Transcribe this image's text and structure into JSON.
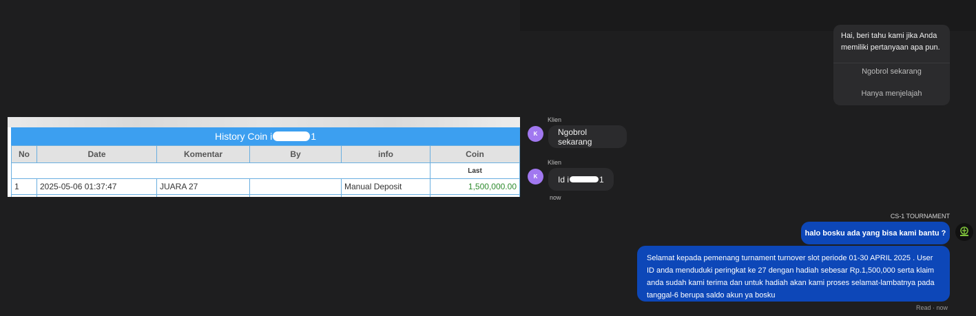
{
  "history": {
    "title_prefix": "History Coin i",
    "title_suffix": "1",
    "columns": [
      "No",
      "Date",
      "Komentar",
      "By",
      "info",
      "Coin"
    ],
    "subheader_last": "Last",
    "rows": [
      {
        "no": "1",
        "date": "2025-05-06 01:37:47",
        "komentar": "JUARA 27",
        "by": "",
        "info": "Manual Deposit",
        "coin": "1,500,000.00"
      }
    ]
  },
  "chat": {
    "welcome": {
      "text": "Hai, beri tahu kami jika Anda memiliki pertanyaan apa pun.",
      "option_1": "Ngobrol sekarang",
      "option_2": "Hanya menjelajah"
    },
    "client_msg_1": {
      "sender": "Klien",
      "avatar": "K",
      "text": "Ngobrol sekarang"
    },
    "client_msg_2": {
      "sender": "Klien",
      "avatar": "K",
      "text_prefix": "Id i",
      "text_suffix": "1",
      "time": "now"
    },
    "agent": {
      "name": "CS-1 TOURNAMENT",
      "msg_1": "halo bosku ada yang bisa kami bantu ?",
      "msg_2": "Selamat kepada pemenang turnament turnover slot periode 01-30 APRIL 2025 . User ID anda menduduki peringkat ke 27 dengan hadiah sebesar Rp.1,500,000 serta klaim anda sudah kami terima dan untuk hadiah akan kami proses selamat-lambatnya pada tanggal-6 berupa saldo akun ya bosku",
      "read_status": "Read · now"
    },
    "colors": {
      "agent_bubble": "#0d47b8",
      "client_bubble": "#2b2b2d",
      "avatar": "#a178f0"
    }
  }
}
